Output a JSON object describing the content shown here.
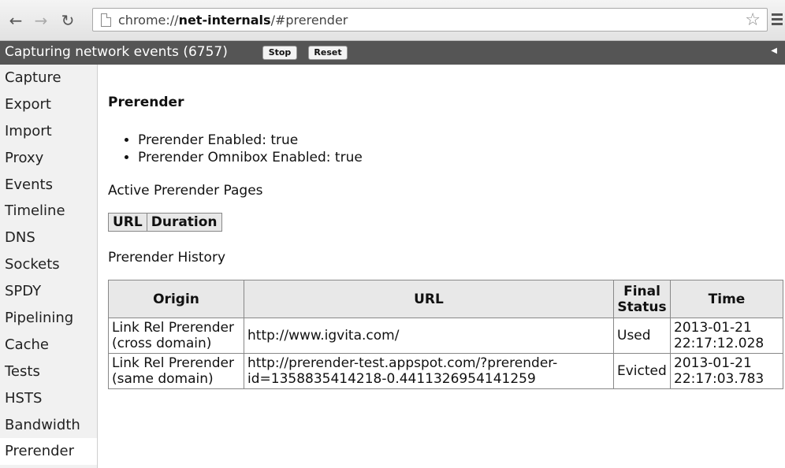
{
  "browser": {
    "url_prefix": "chrome://",
    "url_host": "net-internals",
    "url_suffix": "/#prerender"
  },
  "status": {
    "text": "Capturing network events (6757)",
    "stop_label": "Stop",
    "reset_label": "Reset"
  },
  "sidebar": {
    "items": [
      {
        "label": "Capture"
      },
      {
        "label": "Export"
      },
      {
        "label": "Import"
      },
      {
        "label": "Proxy"
      },
      {
        "label": "Events"
      },
      {
        "label": "Timeline"
      },
      {
        "label": "DNS"
      },
      {
        "label": "Sockets"
      },
      {
        "label": "SPDY"
      },
      {
        "label": "Pipelining"
      },
      {
        "label": "Cache"
      },
      {
        "label": "Tests"
      },
      {
        "label": "HSTS"
      },
      {
        "label": "Bandwidth"
      },
      {
        "label": "Prerender"
      }
    ],
    "selected": "Prerender"
  },
  "main": {
    "title": "Prerender",
    "features": [
      "Prerender Enabled: true",
      "Prerender Omnibox Enabled: true"
    ],
    "active_label": "Active Prerender Pages",
    "active_headers": [
      "URL",
      "Duration"
    ],
    "history_label": "Prerender History",
    "history_headers": [
      "Origin",
      "URL",
      "Final Status",
      "Time"
    ],
    "history_rows": [
      {
        "origin": "Link Rel Prerender (cross domain)",
        "url": "http://www.igvita.com/",
        "status": "Used",
        "time": "2013-01-21 22:17:12.028"
      },
      {
        "origin": "Link Rel Prerender (same domain)",
        "url": "http://prerender-test.appspot.com/?prerender-id=1358835414218-0.4411326954141259",
        "status": "Evicted",
        "time": "2013-01-21 22:17:03.783"
      }
    ]
  }
}
